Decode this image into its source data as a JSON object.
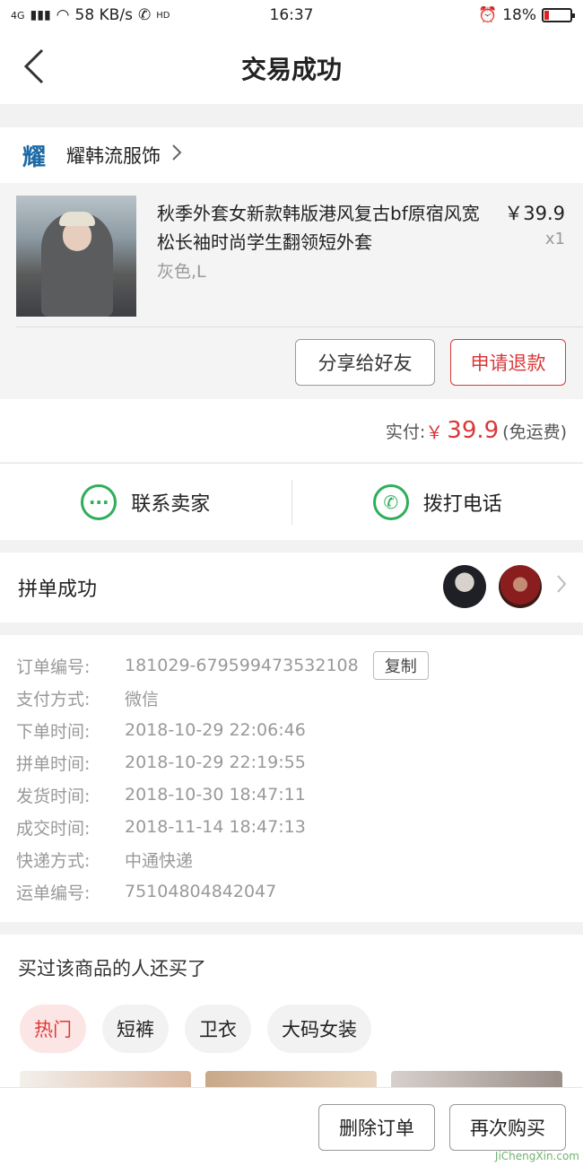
{
  "status_bar": {
    "network": "4G",
    "speed": "58 KB/s",
    "hd": "HD",
    "time": "16:37",
    "battery": "18%",
    "battery_level": 0.18
  },
  "nav": {
    "title": "交易成功"
  },
  "shop": {
    "logo_char": "耀",
    "name": "耀韩流服饰"
  },
  "product": {
    "title": "秋季外套女新款韩版港风复古bf原宿风宽松长袖时尚学生翻领短外套",
    "spec": "灰色,L",
    "price": "￥39.9",
    "qty": "x1",
    "share_button": "分享给好友",
    "refund_button": "申请退款"
  },
  "payment": {
    "label": "实付:",
    "currency": "￥",
    "amount": "39.9",
    "note": "(免运费)"
  },
  "contact": {
    "seller": "联系卖家",
    "call": "拨打电话"
  },
  "group_buy": {
    "label": "拼单成功"
  },
  "order_info": {
    "copy_button": "复制",
    "rows": [
      {
        "key": "订单编号:",
        "value": "181029-679599473532108"
      },
      {
        "key": "支付方式:",
        "value": "微信"
      },
      {
        "key": "下单时间:",
        "value": "2018-10-29 22:06:46"
      },
      {
        "key": "拼单时间:",
        "value": "2018-10-29 22:19:55"
      },
      {
        "key": "发货时间:",
        "value": "2018-10-30 18:47:11"
      },
      {
        "key": "成交时间:",
        "value": "2018-11-14 18:47:13"
      },
      {
        "key": "快递方式:",
        "value": "中通快递"
      },
      {
        "key": "运单编号:",
        "value": "75104804842047"
      }
    ]
  },
  "recommend": {
    "title": "买过该商品的人还买了",
    "chips": [
      "热门",
      "短裤",
      "卫衣",
      "大码女装"
    ]
  },
  "bottom": {
    "delete_button": "删除订单",
    "rebuy_button": "再次购买",
    "watermark": "JiChengXin.com"
  }
}
